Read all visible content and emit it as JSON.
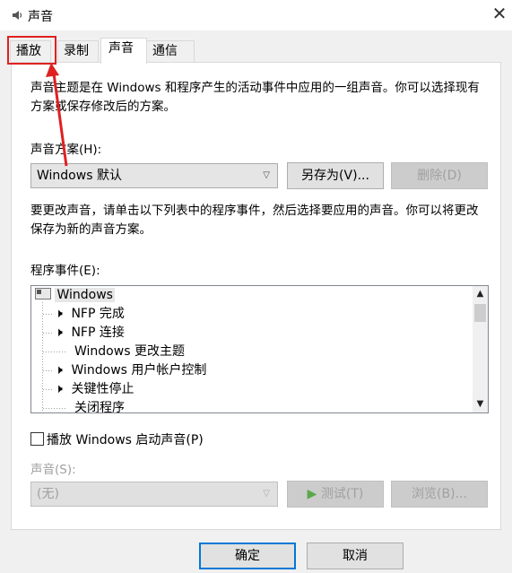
{
  "window": {
    "title": "声音",
    "close_glyph": "✕"
  },
  "tabs": [
    {
      "label": "播放"
    },
    {
      "label": "录制"
    },
    {
      "label": "声音"
    },
    {
      "label": "通信"
    }
  ],
  "description": "声音主题是在 Windows 和程序产生的活动事件中应用的一组声音。你可以选择现有方案或保存修改后的方案。",
  "scheme": {
    "label": "声音方案(H):",
    "selected": "Windows 默认",
    "save_as_label": "另存为(V)...",
    "delete_label": "删除(D)"
  },
  "instructions": "要更改声音，请单击以下列表中的程序事件，然后选择要应用的声音。你可以将更改保存为新的声音方案。",
  "events": {
    "label": "程序事件(E):",
    "items": [
      {
        "text": "Windows",
        "type": "root"
      },
      {
        "text": "NFP 完成",
        "type": "sound"
      },
      {
        "text": "NFP 连接",
        "type": "sound"
      },
      {
        "text": "Windows 更改主题",
        "type": "none"
      },
      {
        "text": "Windows 用户帐户控制",
        "type": "sound"
      },
      {
        "text": "关键性停止",
        "type": "sound"
      },
      {
        "text": "关闭程序",
        "type": "none"
      }
    ]
  },
  "startup_checkbox": {
    "label": "播放 Windows 启动声音(P)",
    "checked": false
  },
  "sound": {
    "label": "声音(S):",
    "selected": "(无)",
    "test_label": "测试(T)",
    "browse_label": "浏览(B)..."
  },
  "footer": {
    "ok_label": "确定",
    "cancel_label": "取消"
  },
  "colors": {
    "annotation": "#e02020"
  }
}
